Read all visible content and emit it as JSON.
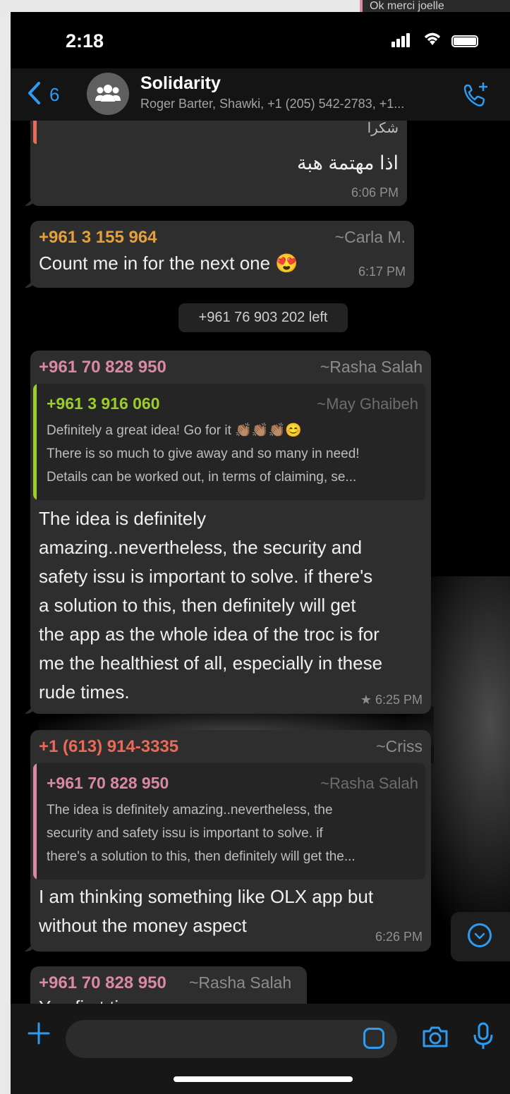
{
  "top_strip": {
    "text": "Ok merci joelle"
  },
  "status": {
    "time": "2:18"
  },
  "header": {
    "back_count": "6",
    "title": "Solidarity",
    "subtitle": "Roger Barter, Shawki, +1 (205) 542-2783, +1..."
  },
  "messages": {
    "m1": {
      "quote_partial": "شكرا",
      "text": "اذا مهتمة هبة",
      "time": "6:06 PM"
    },
    "m2": {
      "sender": "+961 3 155 964",
      "alias": "~Carla M.",
      "text": "Count me in for the next one 😍",
      "time": "6:17 PM"
    },
    "system": "+961 76 903 202 left",
    "m3": {
      "sender": "+961 70 828 950",
      "alias": "~Rasha Salah",
      "quote": {
        "sender": "+961 3 916 060",
        "alias": "~May Ghaibeh",
        "lines": [
          "Definitely a great idea! Go for it 👏🏽👏🏽👏🏽😊",
          "There is so much to give away and so many in need!",
          "Details can be worked out, in terms of claiming, se..."
        ]
      },
      "lines": [
        "The idea is definitely",
        "amazing..nevertheless, the security and",
        "safety issu is important to solve. if there's",
        "a solution to this, then definitely will get",
        "the app as the whole idea of the troc is for",
        "me the healthiest of all, especially in these",
        "rude times."
      ],
      "time": "★ 6:25 PM"
    },
    "m4": {
      "sender": "+1 (613) 914-3335",
      "alias": "~Criss",
      "quote": {
        "sender": "+961 70 828 950",
        "alias": "~Rasha Salah",
        "lines": [
          "The idea is definitely amazing..nevertheless, the",
          "security and safety issu is important to solve. if",
          "there's a solution to this, then definitely will get the..."
        ]
      },
      "lines": [
        "I am thinking something like OLX app but",
        "without the money aspect"
      ],
      "time": "6:26 PM"
    },
    "m5": {
      "sender": "+961 70 828 950",
      "alias": "~Rasha Salah",
      "partial": "You first ti..."
    }
  },
  "colors": {
    "accent": "#2e9bf0",
    "carla": "#e5a03a",
    "rasha": "#d98aa2",
    "may": "#9ccd2a",
    "criss": "#ea6a57"
  },
  "icons": [
    "chevron-left-icon",
    "group-icon",
    "add-call-icon",
    "plus-icon",
    "sticker-icon",
    "camera-icon",
    "mic-icon",
    "chevron-down-icon"
  ]
}
